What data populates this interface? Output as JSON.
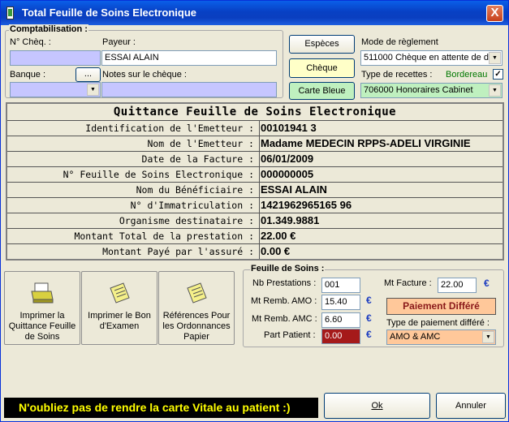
{
  "window": {
    "title": "Total Feuille de Soins Electronique",
    "close": "X"
  },
  "compta": {
    "legend": "Comptabilisation :",
    "cheque_no_label": "N° Chèq. :",
    "cheque_no_value": "",
    "payeur_label": "Payeur :",
    "payeur_value": "ESSAI ALAIN",
    "banque_label": "Banque :",
    "banque_btn": "...",
    "banque_value": "",
    "notes_label": "Notes sur le chèque :",
    "notes_value": "",
    "btn_especes": "Espèces",
    "btn_cheque": "Chèque",
    "btn_carte": "Carte Bleue",
    "mode_label": "Mode de règlement",
    "mode_value": "511000 Chèque en attente de d",
    "bordereau_label": "Bordereau",
    "bordereau_checked": "✓",
    "recettes_label": "Type de recettes :",
    "recettes_value": "706000 Honoraires Cabinet"
  },
  "receipt": {
    "title": "Quittance Feuille de Soins Electronique",
    "rows": [
      {
        "k": "Identification de l'Emetteur :",
        "v": "00101941 3"
      },
      {
        "k": "Nom de l'Emetteur :",
        "v": "Madame MEDECIN RPPS-ADELI VIRGINIE"
      },
      {
        "k": "Date de la Facture :",
        "v": "06/01/2009"
      },
      {
        "k": "N° Feuille de Soins Electronique :",
        "v": "000000005"
      },
      {
        "k": "Nom du Bénéficiaire :",
        "v": "ESSAI ALAIN"
      },
      {
        "k": "N° d'Immatriculation :",
        "v": "1421962965165 96"
      },
      {
        "k": "Organisme destinataire :",
        "v": "01.349.9881"
      },
      {
        "k": "Montant Total de la prestation :",
        "v": "22.00 €"
      },
      {
        "k": "Montant Payé par l'assuré :",
        "v": "0.00 €"
      }
    ]
  },
  "actions": {
    "print_quittance": "Imprimer la Quittance Feuille de Soins",
    "print_bon": "Imprimer le Bon d'Examen",
    "references": "Références Pour les Ordonnances Papier"
  },
  "fds": {
    "legend": "Feuille de Soins :",
    "nb_label": "Nb Prestations :",
    "nb_value": "001",
    "amo_label": "Mt Remb. AMO :",
    "amo_value": "15.40",
    "amc_label": "Mt Remb. AMC :",
    "amc_value": "6.60",
    "part_label": "Part Patient :",
    "part_value": "0.00",
    "facture_label": "Mt Facture :",
    "facture_value": "22.00",
    "euro": "€",
    "diff_title": "Paiement Différé",
    "type_label": "Type de paiement différé :",
    "type_value": "AMO & AMC"
  },
  "footer": {
    "message": "N'oubliez pas de rendre la carte Vitale au patient   :)",
    "ok": "Ok",
    "cancel": "Annuler"
  }
}
